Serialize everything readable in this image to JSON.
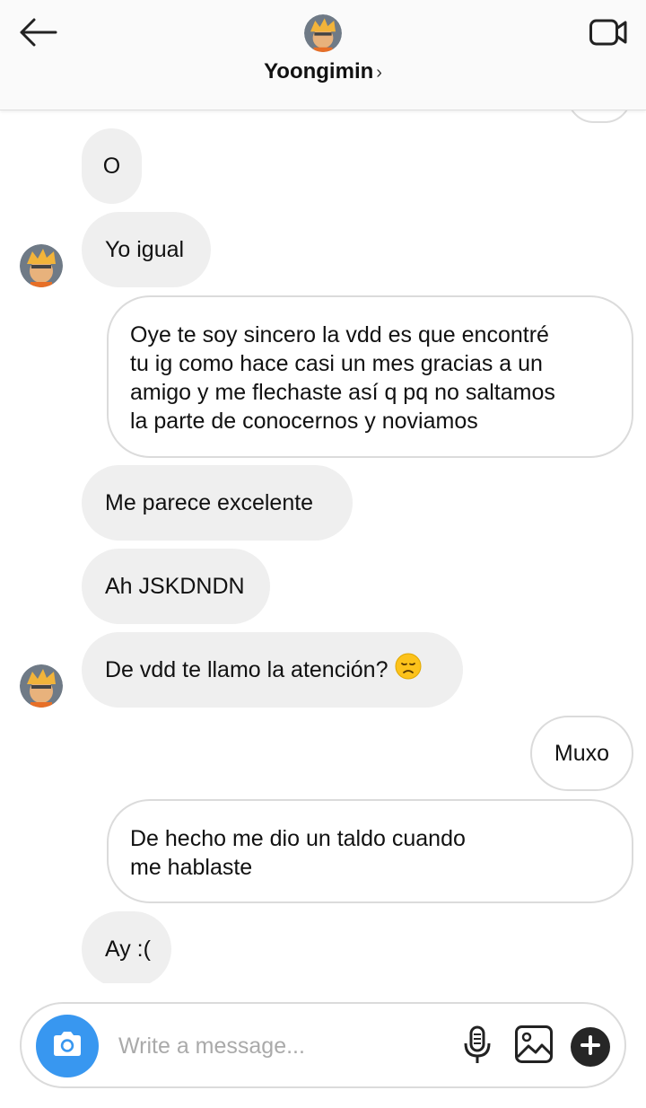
{
  "header": {
    "contact_name": "Yoongimin",
    "chevron": "›",
    "icons": {
      "back": "back-arrow-icon",
      "video": "video-call-icon"
    }
  },
  "messages": [
    {
      "side": "received",
      "text": "O"
    },
    {
      "side": "received",
      "text": "Yo igual"
    },
    {
      "side": "sent",
      "lines": [
        "Oye te soy sincero la vdd es que encontré",
        "tu ig como hace casi un mes gracias a un",
        "amigo y me flechaste así q pq no saltamos",
        "la parte de conocernos y noviamos"
      ]
    },
    {
      "side": "received",
      "text": "Me parece excelente"
    },
    {
      "side": "received",
      "text": "Ah JSKDNDN"
    },
    {
      "side": "received",
      "text": "De vdd te llamo la atención?",
      "emoji": "disappointed-face-emoji"
    },
    {
      "side": "sent",
      "text": "Muxo"
    },
    {
      "side": "sent",
      "lines": [
        "De hecho me dio un taldo cuando",
        "me hablaste"
      ]
    },
    {
      "side": "received",
      "text": "Ay :("
    }
  ],
  "composer": {
    "placeholder": "Write a message...",
    "value": "",
    "icons": {
      "camera": "camera-icon",
      "mic": "microphone-icon",
      "gallery": "gallery-icon",
      "plus": "plus-icon"
    }
  },
  "colors": {
    "header_bg": "#fafafa",
    "received_bubble": "#efefef",
    "sent_border": "#dbdbdb",
    "camera_accent": "#3897f0",
    "plus_button": "#262626"
  }
}
